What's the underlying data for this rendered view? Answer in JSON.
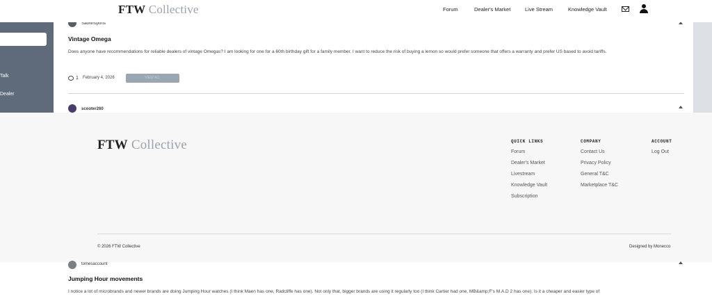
{
  "header": {
    "logo_bold": "FTW",
    "logo_light": "Collective",
    "nav": [
      "Forum",
      "Dealer's Market",
      "Live Stream",
      "Knowledge Vault"
    ],
    "icons": [
      "mail-icon",
      "user-icon"
    ]
  },
  "sidebar": {
    "items": [
      "Talk",
      "Dealer"
    ]
  },
  "posts": [
    {
      "username": "Sadhihsports",
      "title": "Vintage Omega",
      "body": "Does anyone have recommendations for reliable dealers of vintage Omegas? I am looking for one for a 60th birthday gift for a family member. I want to reduce the risk of buying a lemon so would prefer someone that offers a warranty and prefer US based to avoid tariffs.",
      "comment_count": "1",
      "date": "February 4, 2026",
      "view_label": "VIEW ALL"
    },
    {
      "username": "scooter260"
    },
    {
      "username": "tomesaccount",
      "title": "Jumping Hour movements",
      "body": "I notice a lot of microbrands and newer brands are doing Jumping Hour watches (I think Maen has one, Radcliffe has one). Not only that, bigger brands are using it regularly too (I think Cartier had one, MB&amp;F's M.A.D 2 has one). Is it a cheaper and easier type of"
    }
  ],
  "footer": {
    "logo_bold": "FTW",
    "logo_light": "Collective",
    "columns": [
      {
        "heading": "QUICK LINKS",
        "links": [
          "Forum",
          "Dealer's Market",
          "Livestream",
          "Knowledge Vault",
          "Subscription"
        ]
      },
      {
        "heading": "COMPANY",
        "links": [
          "Contact Us",
          "Privacy Policy",
          "General T&C",
          "Marketplace T&C"
        ]
      },
      {
        "heading": "ACCOUNT",
        "links": [
          "Log Out"
        ]
      }
    ],
    "copyright": "© 2026 FTW Collective",
    "designed_by": "Designed by Monecco"
  }
}
